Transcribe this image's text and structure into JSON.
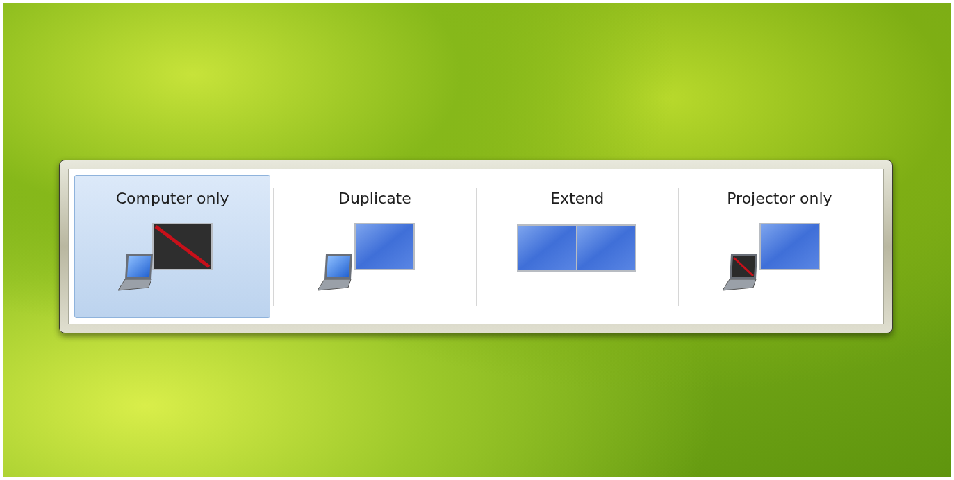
{
  "options": [
    {
      "label": "Computer only",
      "kind": "computer-only",
      "selected": true
    },
    {
      "label": "Duplicate",
      "kind": "duplicate",
      "selected": false
    },
    {
      "label": "Extend",
      "kind": "extend",
      "selected": false
    },
    {
      "label": "Projector only",
      "kind": "projector-only",
      "selected": false
    }
  ]
}
